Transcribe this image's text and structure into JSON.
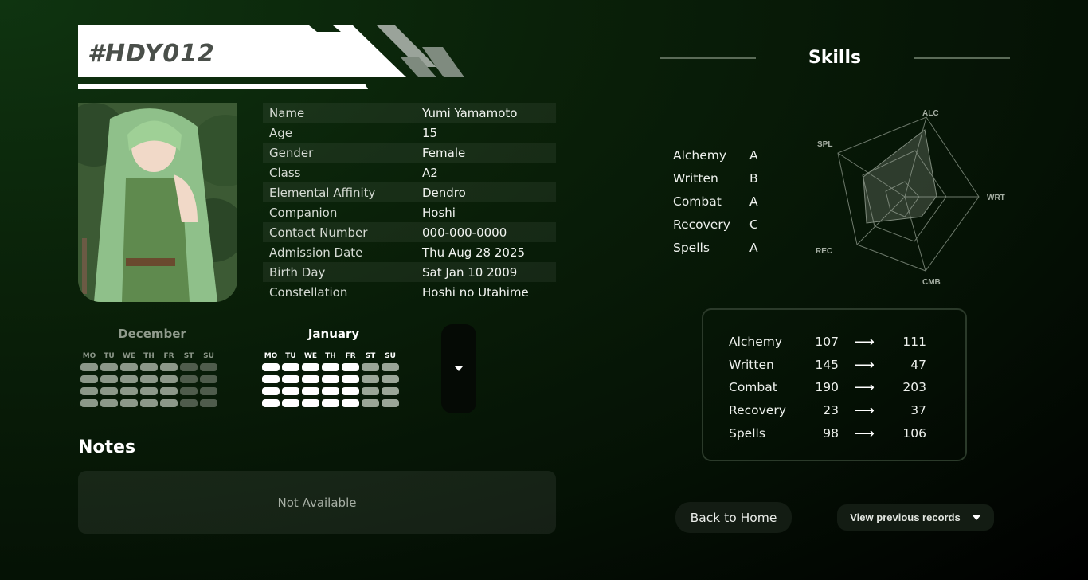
{
  "header": {
    "student_id": "#HDY012"
  },
  "info_rows": [
    {
      "label": "Name",
      "value": "Yumi Yamamoto"
    },
    {
      "label": "Age",
      "value": "15"
    },
    {
      "label": "Gender",
      "value": "Female"
    },
    {
      "label": "Class",
      "value": "A2"
    },
    {
      "label": "Elemental Affinity",
      "value": "Dendro"
    },
    {
      "label": "Companion",
      "value": "Hoshi"
    },
    {
      "label": "Contact Number",
      "value": "000-000-0000"
    },
    {
      "label": "Admission Date",
      "value": "Thu Aug 28 2025"
    },
    {
      "label": "Birth Day",
      "value": "Sat Jan 10 2009"
    },
    {
      "label": "Constellation",
      "value": "Hoshi no Utahime"
    }
  ],
  "calendars": {
    "weekdays": [
      "MO",
      "TU",
      "WE",
      "TH",
      "FR",
      "ST",
      "SU"
    ],
    "previous_month": "December",
    "current_month": "January"
  },
  "notes": {
    "title": "Notes",
    "content": "Not Available"
  },
  "skills": {
    "title": "Skills",
    "grades": [
      {
        "name": "Alchemy",
        "grade": "A"
      },
      {
        "name": "Written",
        "grade": "B"
      },
      {
        "name": "Combat",
        "grade": "A"
      },
      {
        "name": "Recovery",
        "grade": "C"
      },
      {
        "name": "Spells",
        "grade": "A"
      }
    ],
    "radar_axes": [
      "ALC",
      "WRT",
      "CMB",
      "REC",
      "SPL"
    ],
    "stats": [
      {
        "name": "Alchemy",
        "previous": "107",
        "current": "111"
      },
      {
        "name": "Written",
        "previous": "145",
        "current": "47"
      },
      {
        "name": "Combat",
        "previous": "190",
        "current": "203"
      },
      {
        "name": "Recovery",
        "previous": "23",
        "current": "37"
      },
      {
        "name": "Spells",
        "previous": "98",
        "current": "106"
      }
    ],
    "arrow_glyph": "⟶"
  },
  "actions": {
    "back_home": "Back to Home",
    "view_records": "View previous records"
  }
}
